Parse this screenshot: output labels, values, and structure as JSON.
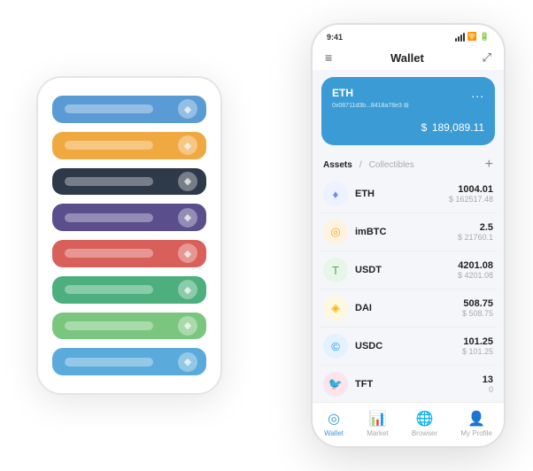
{
  "scene": {
    "back_phone": {
      "cards": [
        {
          "color": "card-blue",
          "icon": "◆"
        },
        {
          "color": "card-orange",
          "icon": "◆"
        },
        {
          "color": "card-dark",
          "icon": "◆"
        },
        {
          "color": "card-purple",
          "icon": "◆"
        },
        {
          "color": "card-red",
          "icon": "◆"
        },
        {
          "color": "card-green",
          "icon": "◆"
        },
        {
          "color": "card-ltgreen",
          "icon": "◆"
        },
        {
          "color": "card-lblue",
          "icon": "◆"
        }
      ]
    },
    "front_phone": {
      "status_bar": {
        "time": "9:41",
        "signal": true,
        "wifi": true,
        "battery": true
      },
      "nav": {
        "menu_icon": "≡",
        "title": "Wallet",
        "expand_icon": "⤢"
      },
      "eth_card": {
        "title": "ETH",
        "address": "0x08711d3b...8418a78e3  ⊞",
        "dots": "...",
        "balance_currency": "$",
        "balance": "189,089.11"
      },
      "assets_header": {
        "tab_active": "Assets",
        "separator": "/",
        "tab_inactive": "Collectibles",
        "add_icon": "+"
      },
      "assets": [
        {
          "name": "ETH",
          "icon": "♦",
          "icon_class": "icon-eth",
          "amount": "1004.01",
          "usd": "$ 162517.48"
        },
        {
          "name": "imBTC",
          "icon": "◎",
          "icon_class": "icon-imbtc",
          "amount": "2.5",
          "usd": "$ 21760.1"
        },
        {
          "name": "USDT",
          "icon": "T",
          "icon_class": "icon-usdt",
          "amount": "4201.08",
          "usd": "$ 4201.08"
        },
        {
          "name": "DAI",
          "icon": "◈",
          "icon_class": "icon-dai",
          "amount": "508.75",
          "usd": "$ 508.75"
        },
        {
          "name": "USDC",
          "icon": "©",
          "icon_class": "icon-usdc",
          "amount": "101.25",
          "usd": "$ 101.25"
        },
        {
          "name": "TFT",
          "icon": "🐦",
          "icon_class": "icon-tft",
          "amount": "13",
          "usd": "0"
        }
      ],
      "bottom_tabs": [
        {
          "key": "wallet",
          "label": "Wallet",
          "icon": "◎",
          "active": true
        },
        {
          "key": "market",
          "label": "Market",
          "icon": "📊",
          "active": false
        },
        {
          "key": "browser",
          "label": "Browser",
          "icon": "🌐",
          "active": false
        },
        {
          "key": "myprofile",
          "label": "My Profile",
          "icon": "👤",
          "active": false
        }
      ]
    }
  }
}
